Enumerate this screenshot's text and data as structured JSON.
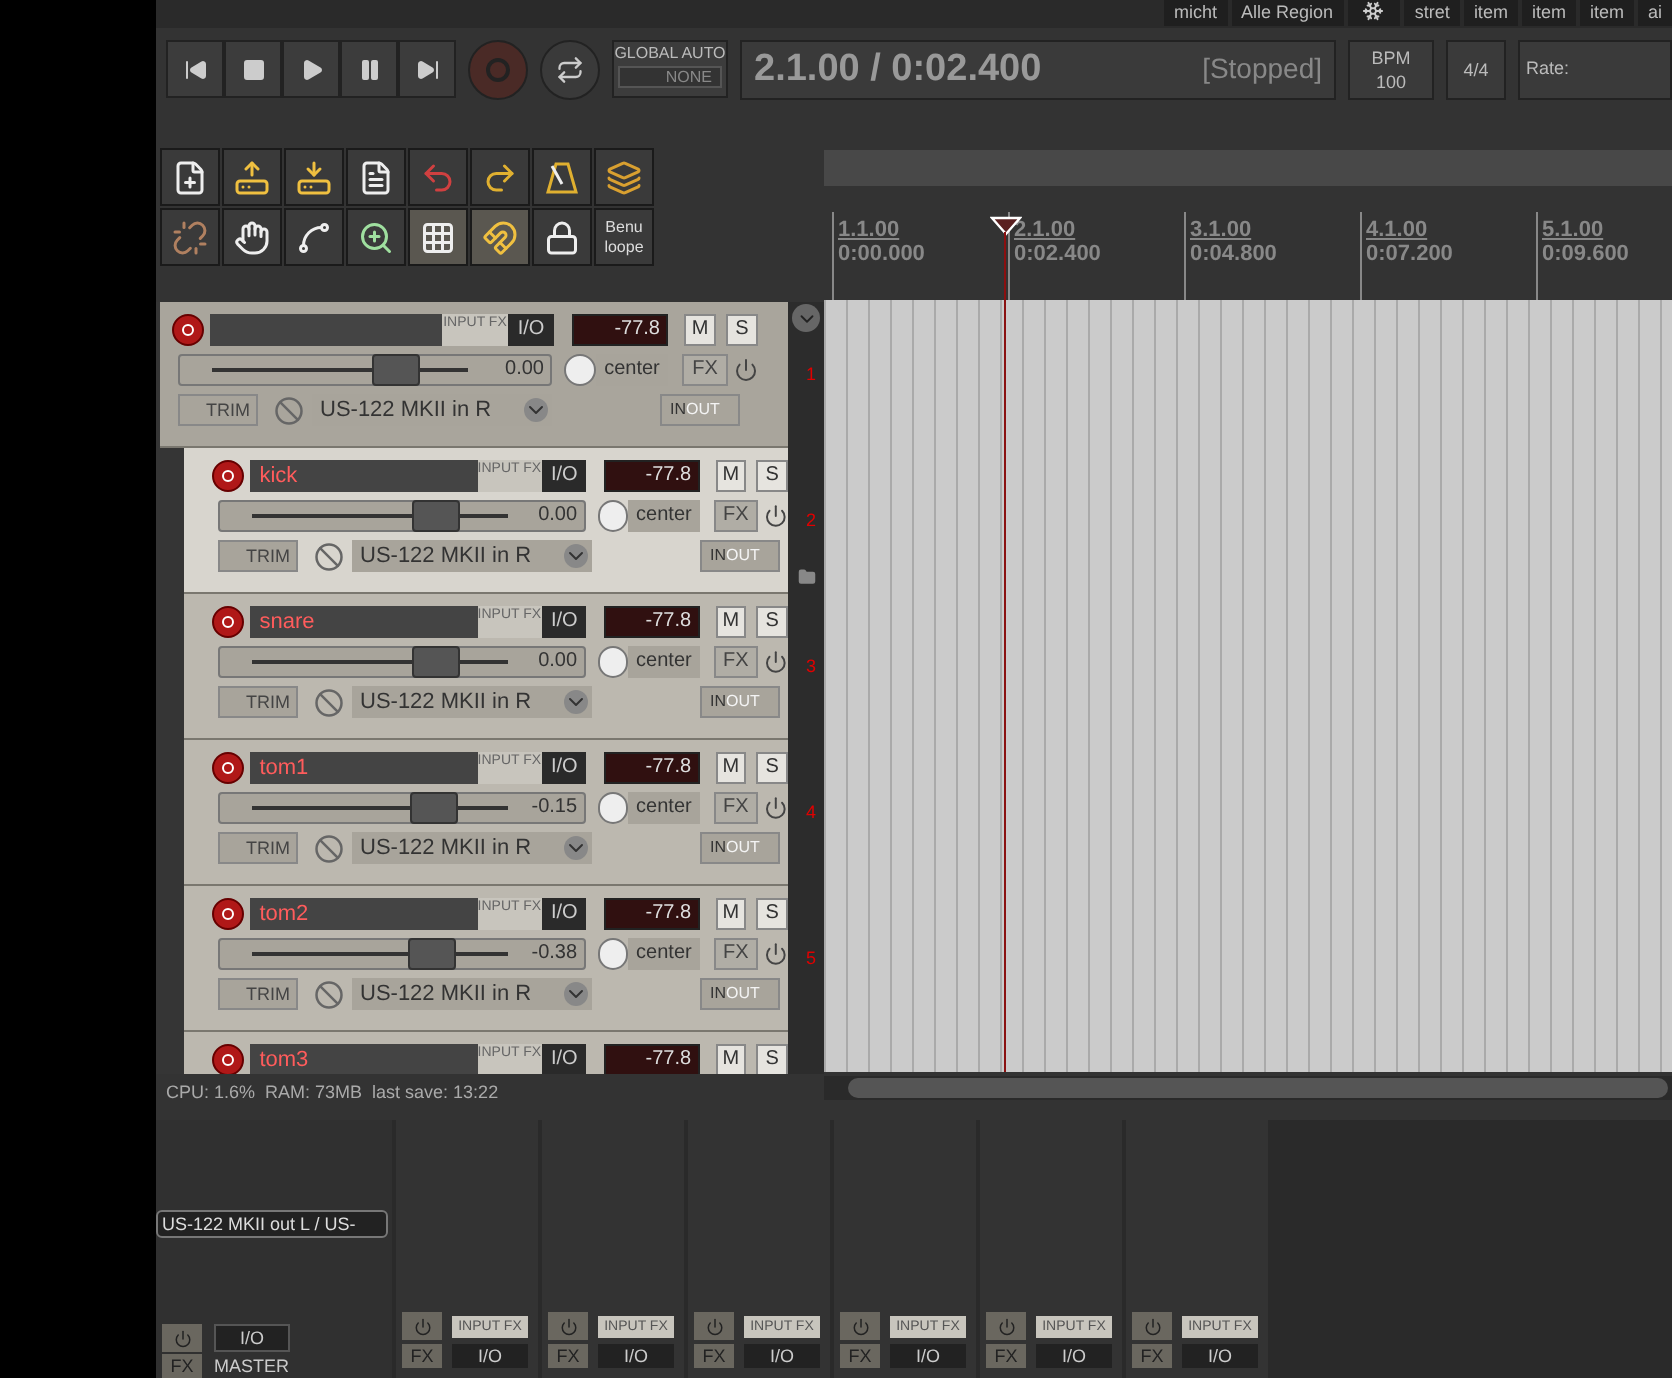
{
  "top_tabs": [
    {
      "kind": "text",
      "label": "micht"
    },
    {
      "kind": "text",
      "label": "Alle Region"
    },
    {
      "kind": "icon"
    },
    {
      "kind": "text",
      "label": "stret"
    },
    {
      "kind": "text",
      "label": "item"
    },
    {
      "kind": "text",
      "label": "item"
    },
    {
      "kind": "text",
      "label": "item"
    },
    {
      "kind": "text",
      "label": "ai"
    }
  ],
  "transport": {
    "global_auto": {
      "title": "GLOBAL AUTO",
      "mode": "NONE"
    },
    "time_display": {
      "position": "2.1.00 / 0:02.400",
      "state": "[Stopped]"
    },
    "tempo": {
      "label": "BPM",
      "value": "100"
    },
    "time_signature": "4/4",
    "rate": {
      "label": "Rate:"
    }
  },
  "toolbar": [
    [
      {
        "kind": "new",
        "on": false
      },
      {
        "kind": "open",
        "on": false
      },
      {
        "kind": "save",
        "on": false
      },
      {
        "kind": "info",
        "on": false
      },
      {
        "kind": "undo",
        "on": false
      },
      {
        "kind": "redo",
        "on": false
      },
      {
        "kind": "metronome",
        "on": false
      },
      {
        "kind": "layers",
        "on": false
      }
    ],
    [
      {
        "kind": "unlink",
        "on": false
      },
      {
        "kind": "grid-hand",
        "on": false
      },
      {
        "kind": "envelope",
        "on": false
      },
      {
        "kind": "zoom",
        "on": false
      },
      {
        "kind": "grid",
        "on": true
      },
      {
        "kind": "magnet",
        "on": true
      },
      {
        "kind": "lock",
        "on": false
      },
      {
        "kind": "text",
        "on": false,
        "label": "Benu loope"
      }
    ]
  ],
  "tracks": [
    {
      "number": "1",
      "selected": false,
      "input_fx": "INPUT FX",
      "io": "I/O",
      "meter": "-77.8",
      "mute": "M",
      "solo": "S",
      "volume": "0.00",
      "level": 0.6,
      "pan": "center",
      "fx": "FX",
      "trim": "TRIM",
      "input": "US-122 MKII in R",
      "monitor_in": "IN",
      "monitor_out": "OUT",
      "children": [
        {
          "name": "kick",
          "number": "2",
          "selected": true,
          "input_fx": "INPUT FX",
          "io": "I/O",
          "meter": "-77.8",
          "mute": "M",
          "solo": "S",
          "volume": "0.00",
          "level": 0.6,
          "pan": "center",
          "fx": "FX",
          "trim": "TRIM",
          "input": "US-122 MKII in R",
          "monitor_in": "IN",
          "monitor_out": "OUT"
        },
        {
          "name": "snare",
          "number": "3",
          "selected": false,
          "input_fx": "INPUT FX",
          "io": "I/O",
          "meter": "-77.8",
          "mute": "M",
          "solo": "S",
          "volume": "0.00",
          "level": 0.6,
          "pan": "center",
          "fx": "FX",
          "trim": "TRIM",
          "input": "US-122 MKII in R",
          "monitor_in": "IN",
          "monitor_out": "OUT"
        },
        {
          "name": "tom1",
          "number": "4",
          "selected": false,
          "input_fx": "INPUT FX",
          "io": "I/O",
          "meter": "-77.8",
          "mute": "M",
          "solo": "S",
          "volume": "-0.15",
          "level": 0.595,
          "pan": "center",
          "fx": "FX",
          "trim": "TRIM",
          "input": "US-122 MKII in R",
          "monitor_in": "IN",
          "monitor_out": "OUT"
        },
        {
          "name": "tom2",
          "number": "5",
          "selected": false,
          "input_fx": "INPUT FX",
          "io": "I/O",
          "meter": "-77.8",
          "mute": "M",
          "solo": "S",
          "volume": "-0.38",
          "level": 0.59,
          "pan": "center",
          "fx": "FX",
          "trim": "TRIM",
          "input": "US-122 MKII in R",
          "monitor_in": "IN",
          "monitor_out": "OUT"
        },
        {
          "name": "tom3",
          "selected": false,
          "input_fx": "INPUT FX",
          "io": "I/O",
          "meter": "-77.8",
          "mute": "M",
          "solo": "S"
        }
      ]
    }
  ],
  "status_bar": "CPU: 1.6%  RAM: 73MB  last save: 13:22",
  "ruler": [
    {
      "bar": "1.1.00",
      "time": "0:00.000"
    },
    {
      "bar": "2.1.00",
      "time": "0:02.400"
    },
    {
      "bar": "3.1.00",
      "time": "0:04.800"
    },
    {
      "bar": "4.1.00",
      "time": "0:07.200"
    },
    {
      "bar": "5.1.00",
      "time": "0:09.600"
    }
  ],
  "mixer": {
    "master": {
      "output": "US-122 MKII out L / US-",
      "io": "I/O",
      "fx": "FX",
      "name": "MASTER"
    },
    "strips": [
      {
        "input_fx": "INPUT FX",
        "fx": "FX",
        "io": "I/O"
      },
      {
        "input_fx": "INPUT FX",
        "fx": "FX",
        "io": "I/O"
      },
      {
        "input_fx": "INPUT FX",
        "fx": "FX",
        "io": "I/O"
      },
      {
        "input_fx": "INPUT FX",
        "fx": "FX",
        "io": "I/O"
      },
      {
        "input_fx": "INPUT FX",
        "fx": "FX",
        "io": "I/O"
      },
      {
        "input_fx": "INPUT FX",
        "fx": "FX",
        "io": "I/O"
      }
    ]
  }
}
